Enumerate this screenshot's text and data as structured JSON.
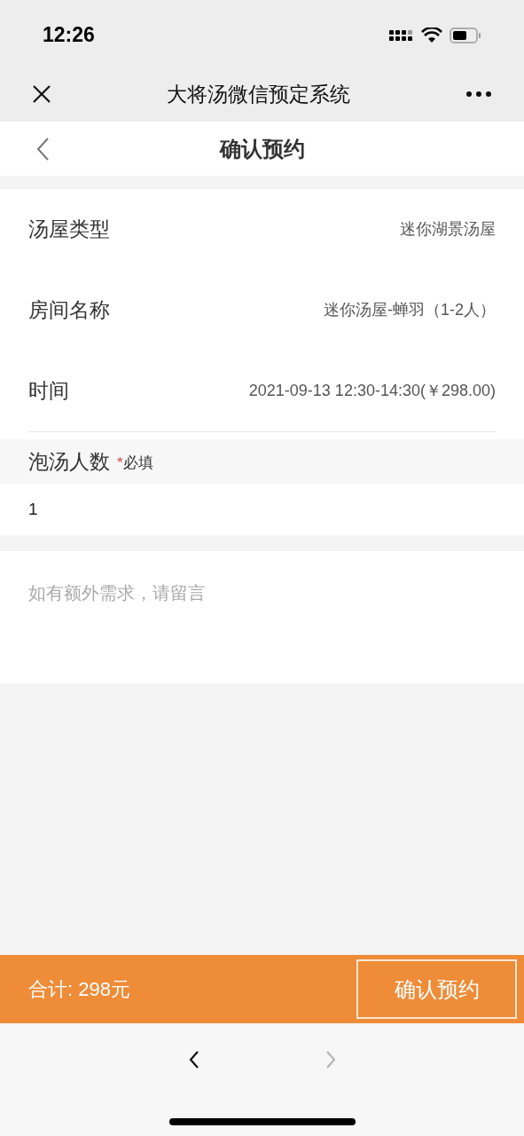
{
  "status_bar": {
    "time": "12:26"
  },
  "wechat_bar": {
    "title": "大将汤微信预定系统"
  },
  "header": {
    "title": "确认预约"
  },
  "details": [
    {
      "label": "汤屋类型",
      "value": "迷你湖景汤屋"
    },
    {
      "label": "房间名称",
      "value": "迷你汤屋-蝉羽（1-2人）"
    },
    {
      "label": "时间",
      "value": "2021-09-13 12:30-14:30(￥298.00)"
    }
  ],
  "guests": {
    "label": "泡汤人数",
    "required_mark": "*",
    "required_text": "必填",
    "value": "1"
  },
  "note": {
    "placeholder": "如有额外需求，请留言"
  },
  "footer": {
    "total": "合计: 298元",
    "button": "确认预约"
  },
  "browser_nav": {
    "back_disabled": false,
    "forward_disabled": true
  }
}
